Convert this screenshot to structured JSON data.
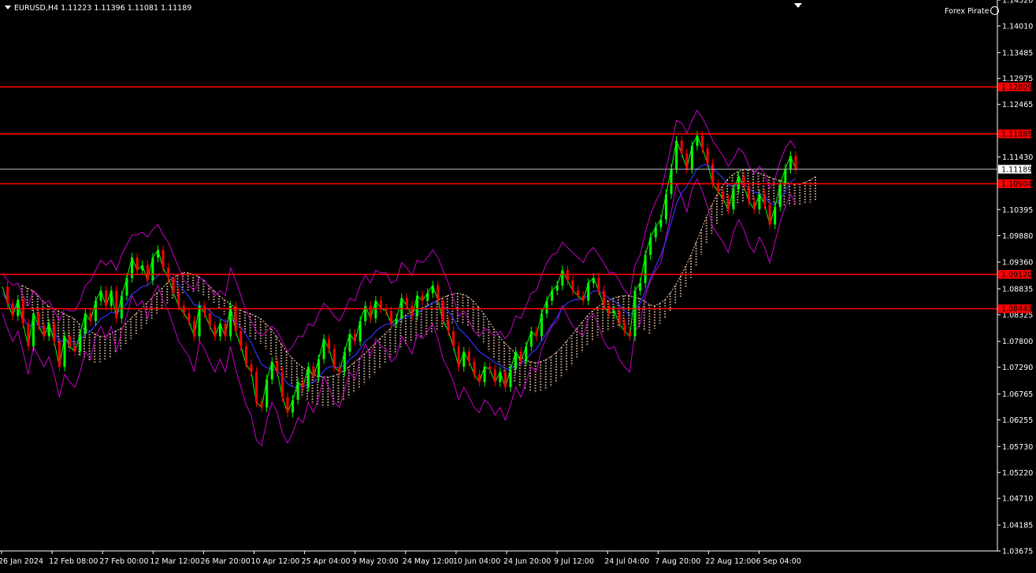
{
  "header": {
    "symbol_timeframe": "EURUSD,H4",
    "quote": "1.11223 1.11396 1.11081 1.11189"
  },
  "brand": {
    "label": "Forex Pirate",
    "icon": "smiley-icon"
  },
  "colors": {
    "background": "#000000",
    "level_line": "#ff0000",
    "price_line": "#c0c0c0",
    "price_green": "#00ff00",
    "price_red": "#ff0000",
    "bands": "#cc00cc",
    "moving_average": "#3333ff",
    "ichimoku_cloud": "#ffd0b0",
    "axis_text": "#ffffff"
  },
  "chart_data": {
    "type": "line",
    "title": "",
    "symbol": "EURUSD",
    "timeframe": "H4",
    "x_tick_labels": [
      "26 Jan 2024",
      "12 Feb 08:00",
      "27 Feb 00:00",
      "12 Mar 12:00",
      "26 Mar 20:00",
      "10 Apr 12:00",
      "25 Apr 04:00",
      "9 May 20:00",
      "24 May 12:00",
      "10 Jun 04:00",
      "24 Jun 20:00",
      "9 Jul 12:00",
      "24 Jul 04:00",
      "7 Aug 20:00",
      "22 Aug 12:00",
      "6 Sep 04:00"
    ],
    "y_tick_labels": [
      "1.14520",
      "1.14010",
      "1.13485",
      "1.12975",
      "1.12465",
      "1.11430",
      "1.10395",
      "1.09880",
      "1.09360",
      "1.08835",
      "1.08325",
      "1.07800",
      "1.07290",
      "1.06765",
      "1.06255",
      "1.05730",
      "1.05220",
      "1.04710",
      "1.04185",
      "1.03675"
    ],
    "ylim": [
      1.03675,
      1.1452
    ],
    "levels": [
      {
        "label": "1.12809",
        "value": 1.12809
      },
      {
        "label": "1.11885",
        "value": 1.11885
      },
      {
        "label": "1.10904",
        "value": 1.10904
      },
      {
        "label": "1.09120",
        "value": 1.0912
      },
      {
        "label": "1.08443",
        "value": 1.08443
      }
    ],
    "current_price": {
      "label": "1.11189",
      "value": 1.11189
    },
    "grid": false,
    "series": [
      {
        "style": "price",
        "values": [
          1.0888,
          1.0855,
          1.083,
          1.0862,
          1.0815,
          1.077,
          1.0835,
          1.081,
          1.079,
          1.0815,
          1.078,
          1.073,
          1.079,
          1.077,
          1.076,
          1.0795,
          1.0835,
          1.082,
          1.086,
          1.088,
          1.085,
          1.088,
          1.0825,
          1.087,
          1.0905,
          1.0945,
          1.092,
          1.093,
          1.09,
          1.0945,
          1.096,
          1.0925,
          1.0905,
          1.0875,
          1.085,
          1.0835,
          1.082,
          1.079,
          1.085,
          1.0835,
          1.081,
          1.079,
          1.0815,
          1.079,
          1.085,
          1.08,
          1.077,
          1.0735,
          1.072,
          1.066,
          1.065,
          1.0705,
          1.074,
          1.072,
          1.067,
          1.064,
          1.0665,
          1.07,
          1.069,
          1.073,
          1.071,
          1.0745,
          1.0785,
          1.0765,
          1.073,
          1.072,
          1.076,
          1.0795,
          1.078,
          1.082,
          1.085,
          1.0825,
          1.086,
          1.0845,
          1.084,
          1.0815,
          1.0825,
          1.0865,
          1.085,
          1.083,
          1.087,
          1.086,
          1.0875,
          1.089,
          1.086,
          1.082,
          1.08,
          1.077,
          1.073,
          1.076,
          1.074,
          1.0715,
          1.07,
          1.073,
          1.0725,
          1.07,
          1.072,
          1.069,
          1.0725,
          1.076,
          1.074,
          1.077,
          1.08,
          1.079,
          1.0835,
          1.086,
          1.088,
          1.089,
          1.092,
          1.09,
          1.088,
          1.087,
          1.086,
          1.0895,
          1.0905,
          1.088,
          1.085,
          1.0835,
          1.084,
          1.0815,
          1.08,
          1.079,
          1.088,
          1.0895,
          1.095,
          1.0985,
          1.1005,
          1.102,
          1.107,
          1.112,
          1.1175,
          1.115,
          1.112,
          1.1165,
          1.1185,
          1.116,
          1.113,
          1.109,
          1.1075,
          1.106,
          1.104,
          1.108,
          1.1105,
          1.1085,
          1.1055,
          1.104,
          1.107,
          1.105,
          1.101,
          1.1045,
          1.109,
          1.112,
          1.1145,
          1.1119
        ]
      },
      {
        "style": "bands-upper",
        "values": [
          1.0915,
          1.09,
          1.089,
          1.0895,
          1.087,
          1.085,
          1.088,
          1.087,
          1.0855,
          1.086,
          1.084,
          1.082,
          1.0845,
          1.084,
          1.084,
          1.086,
          1.089,
          1.09,
          1.092,
          1.094,
          1.093,
          1.094,
          1.092,
          1.095,
          1.097,
          1.099,
          1.099,
          1.0995,
          1.0985,
          1.1,
          1.101,
          1.099,
          1.0975,
          1.095,
          1.0925,
          1.09,
          1.089,
          1.088,
          1.0905,
          1.09,
          1.0885,
          1.087,
          1.088,
          1.087,
          1.0925,
          1.09,
          1.087,
          1.084,
          1.082,
          1.08,
          1.079,
          1.08,
          1.081,
          1.08,
          1.078,
          1.076,
          1.077,
          1.079,
          1.079,
          1.0815,
          1.081,
          1.0835,
          1.0855,
          1.0845,
          1.083,
          1.082,
          1.084,
          1.0865,
          1.086,
          1.089,
          1.091,
          1.0895,
          1.092,
          1.0915,
          1.0915,
          1.0895,
          1.09,
          1.0935,
          1.0925,
          1.091,
          1.094,
          1.0935,
          1.0945,
          1.096,
          1.0945,
          1.092,
          1.0895,
          1.0865,
          1.083,
          1.084,
          1.082,
          1.08,
          1.079,
          1.0805,
          1.08,
          1.079,
          1.08,
          1.0785,
          1.08,
          1.083,
          1.0825,
          1.085,
          1.0875,
          1.088,
          1.091,
          1.0935,
          1.095,
          1.0955,
          1.0975,
          1.0965,
          1.0955,
          1.0945,
          1.0935,
          1.0955,
          1.0965,
          1.095,
          1.0935,
          1.0915,
          1.0915,
          1.09,
          1.088,
          1.087,
          1.093,
          1.095,
          1.0995,
          1.103,
          1.1055,
          1.1075,
          1.112,
          1.1165,
          1.1215,
          1.121,
          1.119,
          1.1215,
          1.1235,
          1.122,
          1.12,
          1.1175,
          1.116,
          1.1145,
          1.1125,
          1.114,
          1.116,
          1.115,
          1.1125,
          1.111,
          1.1125,
          1.111,
          1.108,
          1.11,
          1.1135,
          1.116,
          1.1175,
          1.116
        ]
      },
      {
        "style": "bands-lower",
        "values": [
          1.0835,
          1.0805,
          1.078,
          1.08,
          1.076,
          1.0715,
          1.077,
          1.075,
          1.073,
          1.075,
          1.0715,
          1.067,
          1.0715,
          1.07,
          1.069,
          1.072,
          1.076,
          1.0745,
          1.079,
          1.081,
          1.0785,
          1.081,
          1.076,
          1.08,
          1.083,
          1.087,
          1.085,
          1.086,
          1.0825,
          1.087,
          1.089,
          1.086,
          1.084,
          1.081,
          1.078,
          1.0765,
          1.075,
          1.072,
          1.078,
          1.0765,
          1.074,
          1.072,
          1.0745,
          1.072,
          1.077,
          1.0725,
          1.069,
          1.0655,
          1.0635,
          1.0585,
          1.0575,
          1.0625,
          1.066,
          1.064,
          1.06,
          1.058,
          1.06,
          1.063,
          1.062,
          1.066,
          1.064,
          1.067,
          1.071,
          1.069,
          1.066,
          1.065,
          1.0685,
          1.072,
          1.0705,
          1.0745,
          1.0775,
          1.075,
          1.0785,
          1.077,
          1.0765,
          1.074,
          1.075,
          1.079,
          1.0775,
          1.0755,
          1.0795,
          1.0785,
          1.08,
          1.0815,
          1.0785,
          1.0745,
          1.0725,
          1.07,
          1.0665,
          1.069,
          1.067,
          1.065,
          1.064,
          1.0665,
          1.0655,
          1.0635,
          1.065,
          1.0625,
          1.0655,
          1.069,
          1.067,
          1.07,
          1.073,
          1.072,
          1.0765,
          1.079,
          1.081,
          1.082,
          1.085,
          1.083,
          1.081,
          1.08,
          1.079,
          1.0825,
          1.0835,
          1.081,
          1.078,
          1.0765,
          1.077,
          1.0745,
          1.073,
          1.072,
          1.08,
          1.0815,
          1.087,
          1.09,
          1.092,
          1.0935,
          1.0985,
          1.1035,
          1.109,
          1.1065,
          1.1035,
          1.108,
          1.11,
          1.1075,
          1.1045,
          1.1005,
          1.099,
          1.0975,
          1.0955,
          1.0995,
          1.102,
          1.1,
          1.097,
          1.0955,
          1.0985,
          1.0965,
          1.0935,
          1.0975,
          1.1015,
          1.1045,
          1.107,
          1.105
        ]
      },
      {
        "style": "moving-average",
        "values": [
          1.0875,
          1.086,
          1.0845,
          1.0848,
          1.083,
          1.0808,
          1.0815,
          1.0812,
          1.0805,
          1.0806,
          1.0798,
          1.078,
          1.0783,
          1.078,
          1.0778,
          1.0783,
          1.0795,
          1.08,
          1.0812,
          1.0825,
          1.083,
          1.0838,
          1.0835,
          1.0843,
          1.0855,
          1.0873,
          1.088,
          1.0888,
          1.089,
          1.09,
          1.091,
          1.0912,
          1.091,
          1.0903,
          1.0892,
          1.088,
          1.0868,
          1.0852,
          1.0851,
          1.0848,
          1.084,
          1.083,
          1.0826,
          1.0818,
          1.0824,
          1.0818,
          1.0808,
          1.0793,
          1.0778,
          1.0755,
          1.0735,
          1.0728,
          1.0726,
          1.0722,
          1.0711,
          1.0697,
          1.069,
          1.069,
          1.069,
          1.0697,
          1.07,
          1.0708,
          1.0722,
          1.073,
          1.073,
          1.0728,
          1.0733,
          1.0745,
          1.0752,
          1.0765,
          1.0781,
          1.0788,
          1.08,
          1.0808,
          1.0814,
          1.0814,
          1.0816,
          1.0825,
          1.083,
          1.083,
          1.0838,
          1.0842,
          1.0849,
          1.0857,
          1.0857,
          1.085,
          1.084,
          1.0825,
          1.0806,
          1.0796,
          1.0785,
          1.0772,
          1.076,
          1.0753,
          1.0746,
          1.0738,
          1.0734,
          1.0726,
          1.0726,
          1.0734,
          1.0736,
          1.0745,
          1.0757,
          1.0765,
          1.0781,
          1.0797,
          1.0814,
          1.0828,
          1.0846,
          1.0856,
          1.0861,
          1.0863,
          1.0863,
          1.0871,
          1.0879,
          1.0879,
          1.0873,
          1.0865,
          1.086,
          1.0851,
          1.0841,
          1.0831,
          1.0843,
          1.0855,
          1.0879,
          1.0904,
          1.0928,
          1.095,
          1.098,
          1.1014,
          1.1051,
          1.1072,
          1.1085,
          1.1103,
          1.112,
          1.1127,
          1.1128,
          1.112,
          1.1111,
          1.1101,
          1.1088,
          1.1086,
          1.109,
          1.1089,
          1.1081,
          1.1073,
          1.1072,
          1.1066,
          1.1052,
          1.105,
          1.106,
          1.1075,
          1.1093,
          1.1101
        ]
      },
      {
        "style": "cloud-upper",
        "values": [
          1.089,
          1.0885,
          1.088,
          1.087,
          1.086,
          1.085,
          1.0845,
          1.084,
          1.0835,
          1.083,
          1.0825,
          1.0815,
          1.0805,
          1.08,
          1.0795,
          1.079,
          1.079,
          1.0795,
          1.08,
          1.0805,
          1.0815,
          1.0825,
          1.0835,
          1.0845,
          1.0855,
          1.0865,
          1.0875,
          1.0885,
          1.0895,
          1.0905,
          1.091,
          1.0915,
          1.0915,
          1.0912,
          1.0908,
          1.09,
          1.089,
          1.088,
          1.087,
          1.0862,
          1.0855,
          1.0848,
          1.0842,
          1.0838,
          1.0835,
          1.083,
          1.0825,
          1.0815,
          1.0805,
          1.079,
          1.0775,
          1.076,
          1.0748,
          1.0738,
          1.073,
          1.0722,
          1.0716,
          1.0712,
          1.071,
          1.071,
          1.0712,
          1.0716,
          1.0722,
          1.073,
          1.0738,
          1.0746,
          1.0755,
          1.0765,
          1.0775,
          1.0785,
          1.0795,
          1.0805,
          1.0815,
          1.0825,
          1.0832,
          1.0838,
          1.0842,
          1.0846,
          1.085,
          1.0855,
          1.086,
          1.0865,
          1.087,
          1.0873,
          1.0875,
          1.0873,
          1.0868,
          1.086,
          1.0848,
          1.0835,
          1.082,
          1.0805,
          1.079,
          1.0778,
          1.0768,
          1.0758,
          1.075,
          1.0744,
          1.074,
          1.0738,
          1.074,
          1.0744,
          1.075,
          1.0758,
          1.0768,
          1.078,
          1.0792,
          1.0805,
          1.0818,
          1.083,
          1.084,
          1.0848,
          1.0855,
          1.086,
          1.0865,
          1.0868,
          1.087,
          1.087,
          1.0868,
          1.0865,
          1.086,
          1.0852,
          1.085,
          1.0855,
          1.0862,
          1.0875,
          1.089,
          1.0908,
          1.0928,
          1.095,
          1.0975,
          1.1,
          1.1025,
          1.1048,
          1.1068,
          1.1085,
          1.1098,
          1.1108,
          1.1114,
          1.1118,
          1.1118,
          1.1116,
          1.1112,
          1.1108,
          1.1104,
          1.11,
          1.1097,
          1.1094,
          1.1091,
          1.1089,
          1.109,
          1.1093,
          1.1098,
          1.1104
        ]
      },
      {
        "style": "cloud-lower",
        "values": [
          1.086,
          1.085,
          1.084,
          1.0825,
          1.081,
          1.0795,
          1.0785,
          1.0778,
          1.077,
          1.0765,
          1.076,
          1.0752,
          1.0745,
          1.074,
          1.0738,
          1.0738,
          1.0742,
          1.0748,
          1.0756,
          1.0765,
          1.0775,
          1.0785,
          1.0795,
          1.0805,
          1.0815,
          1.0825,
          1.0835,
          1.0845,
          1.0855,
          1.0863,
          1.087,
          1.0875,
          1.0878,
          1.0878,
          1.0875,
          1.087,
          1.0862,
          1.0853,
          1.0843,
          1.0833,
          1.0823,
          1.0813,
          1.0804,
          1.0796,
          1.0789,
          1.0782,
          1.0775,
          1.0765,
          1.0753,
          1.0738,
          1.0722,
          1.0706,
          1.0692,
          1.068,
          1.067,
          1.0662,
          1.0656,
          1.0652,
          1.065,
          1.065,
          1.0652,
          1.0656,
          1.0662,
          1.067,
          1.0678,
          1.0686,
          1.0695,
          1.0705,
          1.0715,
          1.0725,
          1.0735,
          1.0745,
          1.0755,
          1.0765,
          1.0772,
          1.0778,
          1.0782,
          1.0786,
          1.079,
          1.0795,
          1.08,
          1.0805,
          1.081,
          1.0813,
          1.0815,
          1.0813,
          1.0808,
          1.08,
          1.0788,
          1.0775,
          1.076,
          1.0745,
          1.073,
          1.0718,
          1.0708,
          1.0698,
          1.069,
          1.0684,
          1.068,
          1.0678,
          1.068,
          1.0684,
          1.069,
          1.0698,
          1.0708,
          1.072,
          1.0732,
          1.0745,
          1.0758,
          1.077,
          1.078,
          1.0788,
          1.0795,
          1.08,
          1.0805,
          1.0808,
          1.081,
          1.081,
          1.0808,
          1.0805,
          1.08,
          1.0795,
          1.0805,
          1.0815,
          1.0825,
          1.0838,
          1.0852,
          1.0868,
          1.0885,
          1.0905,
          1.0928,
          1.095,
          1.0972,
          1.0992,
          1.101,
          1.1025,
          1.1037,
          1.1046,
          1.1052,
          1.1056,
          1.1058,
          1.1058,
          1.1056,
          1.1054,
          1.1052,
          1.105,
          1.1049,
          1.1048,
          1.1047,
          1.1047,
          1.1048,
          1.105,
          1.1053,
          1.1057
        ]
      }
    ]
  }
}
